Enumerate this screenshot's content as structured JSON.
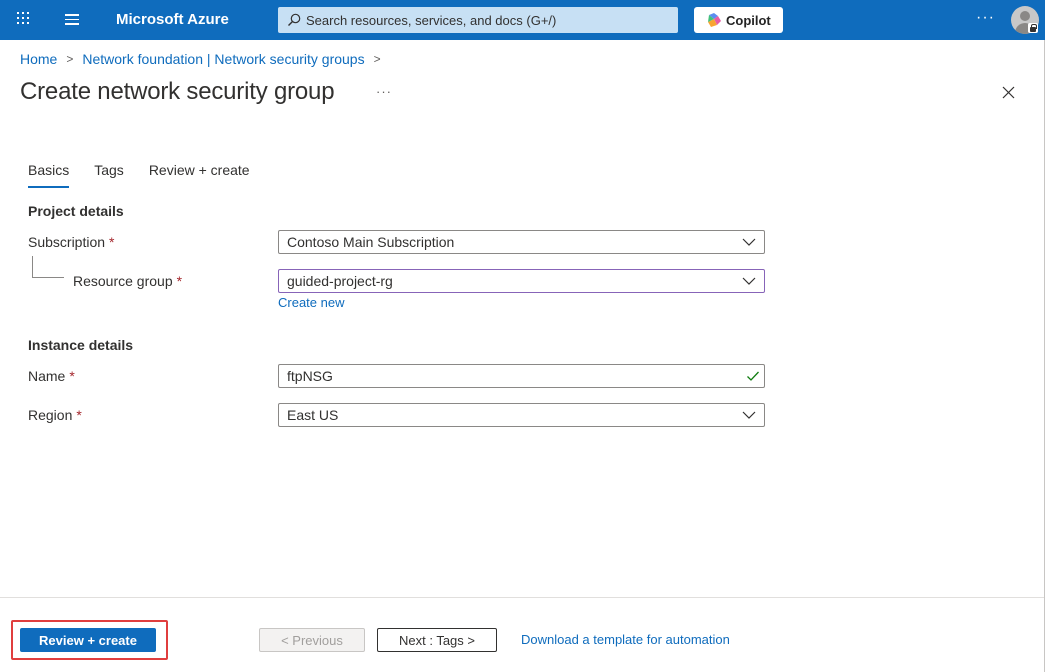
{
  "topbar": {
    "brand": "Microsoft Azure",
    "search_placeholder": "Search resources, services, and docs (G+/)",
    "copilot_label": "Copilot",
    "more_label": "···",
    "icons": [
      "waffle-icon",
      "hamburger-menu-icon",
      "search-icon",
      "copilot-icon",
      "user-avatar-icon"
    ]
  },
  "breadcrumb": {
    "items": [
      "Home",
      "Network foundation | Network security groups"
    ],
    "separator": ">"
  },
  "page": {
    "title": "Create network security group",
    "more_label": "···"
  },
  "tabs": [
    {
      "label": "Basics",
      "active": true
    },
    {
      "label": "Tags",
      "active": false
    },
    {
      "label": "Review + create",
      "active": false
    }
  ],
  "project_details": {
    "title": "Project details",
    "subscription": {
      "label": "Subscription",
      "required": "*",
      "value": "Contoso Main Subscription"
    },
    "resource_group": {
      "label": "Resource group",
      "required": "*",
      "value": "guided-project-rg",
      "create_new": "Create new"
    }
  },
  "instance_details": {
    "title": "Instance details",
    "name": {
      "label": "Name",
      "required": "*",
      "value": "ftpNSG",
      "valid": true
    },
    "region": {
      "label": "Region",
      "required": "*",
      "value": "East US"
    }
  },
  "footer": {
    "review_create": "Review + create",
    "previous": "< Previous",
    "next": "Next : Tags >",
    "download_template": "Download a template for automation"
  },
  "colors": {
    "accent": "#0f6cbd",
    "required": "#a4262c",
    "highlight": "#e03e3e",
    "valid": "#107c10"
  }
}
